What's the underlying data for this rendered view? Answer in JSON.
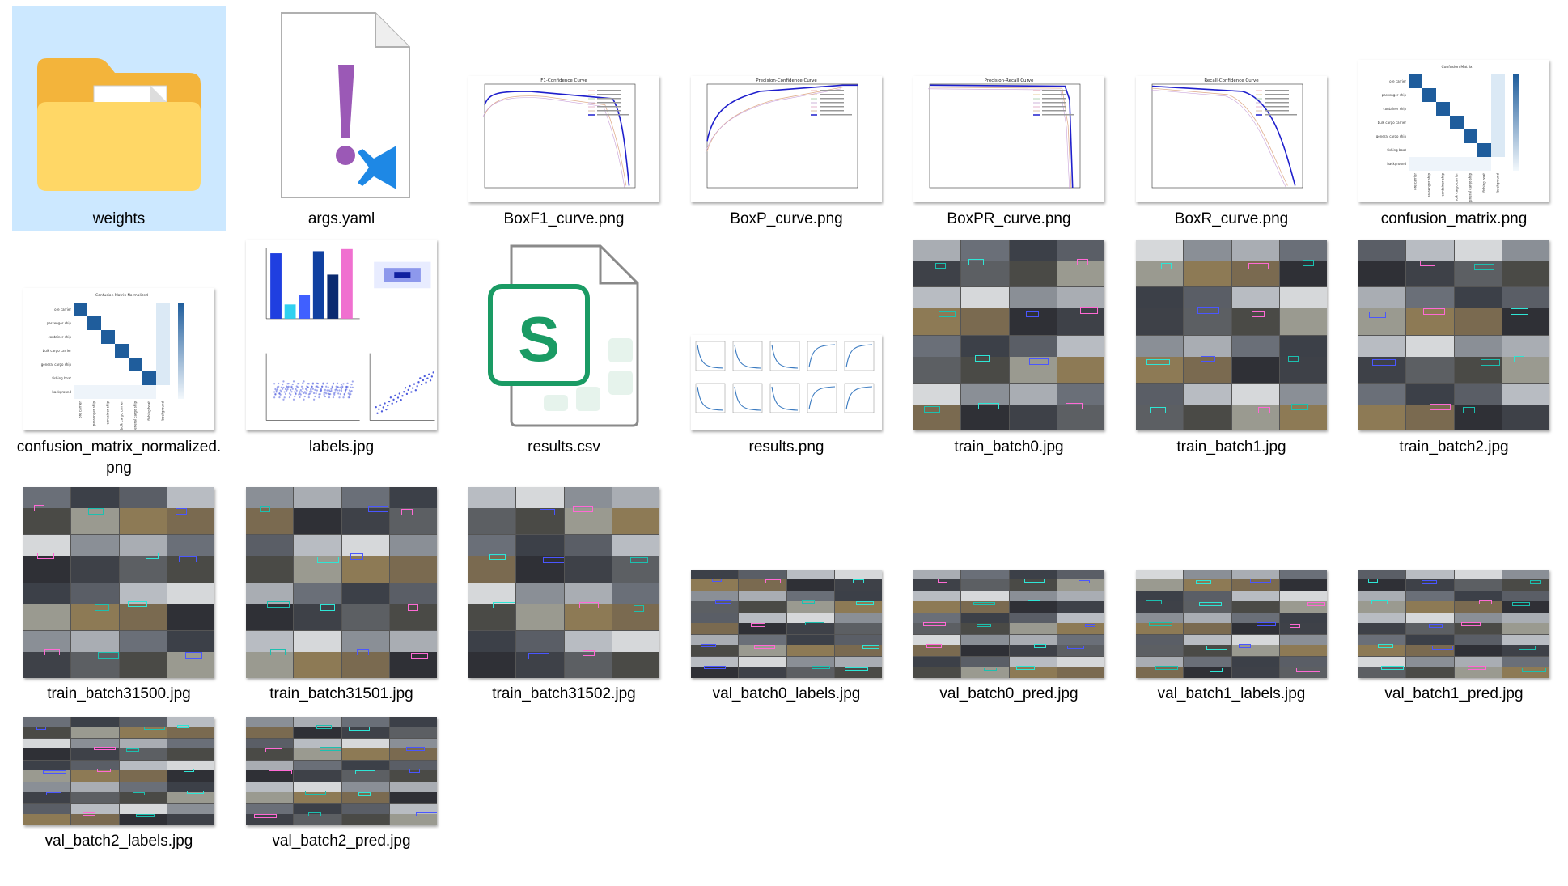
{
  "files": [
    {
      "name": "weights",
      "type": "folder"
    },
    {
      "name": "args.yaml",
      "type": "yaml"
    },
    {
      "name": "BoxF1_curve.png",
      "type": "curve",
      "title": "F1-Confidence Curve"
    },
    {
      "name": "BoxP_curve.png",
      "type": "curve",
      "title": "Precision-Confidence Curve"
    },
    {
      "name": "BoxPR_curve.png",
      "type": "curve",
      "title": "Precision-Recall Curve"
    },
    {
      "name": "BoxR_curve.png",
      "type": "curve",
      "title": "Recall-Confidence Curve"
    },
    {
      "name": "confusion_matrix.png",
      "type": "matrix",
      "title": "Confusion Matrix"
    },
    {
      "name": "confusion_matrix_normalized.png",
      "type": "matrix",
      "title": "Confusion Matrix Normalized"
    },
    {
      "name": "labels.jpg",
      "type": "labels"
    },
    {
      "name": "results.csv",
      "type": "csv"
    },
    {
      "name": "results.png",
      "type": "results"
    },
    {
      "name": "train_batch0.jpg",
      "type": "photo"
    },
    {
      "name": "train_batch1.jpg",
      "type": "photo"
    },
    {
      "name": "train_batch2.jpg",
      "type": "photo"
    },
    {
      "name": "train_batch31500.jpg",
      "type": "photo"
    },
    {
      "name": "train_batch31501.jpg",
      "type": "photo"
    },
    {
      "name": "train_batch31502.jpg",
      "type": "photo"
    },
    {
      "name": "val_batch0_labels.jpg",
      "type": "photo_wide"
    },
    {
      "name": "val_batch0_pred.jpg",
      "type": "photo_wide"
    },
    {
      "name": "val_batch1_labels.jpg",
      "type": "photo_wide"
    },
    {
      "name": "val_batch1_pred.jpg",
      "type": "photo_wide"
    },
    {
      "name": "val_batch2_labels.jpg",
      "type": "photo_wide"
    },
    {
      "name": "val_batch2_pred.jpg",
      "type": "photo_wide"
    }
  ],
  "selected": "weights",
  "colors": {
    "selection": "#cce8ff",
    "folder_back": "#f3b43b",
    "folder_front": "#ffd766",
    "yaml_mark": "#9b59b6",
    "vscode_blue": "#1e88e5",
    "sheets_green": "#1a9b64",
    "curve_blue": "#1f1fcc",
    "matrix_blue": "#1f5d9c"
  }
}
